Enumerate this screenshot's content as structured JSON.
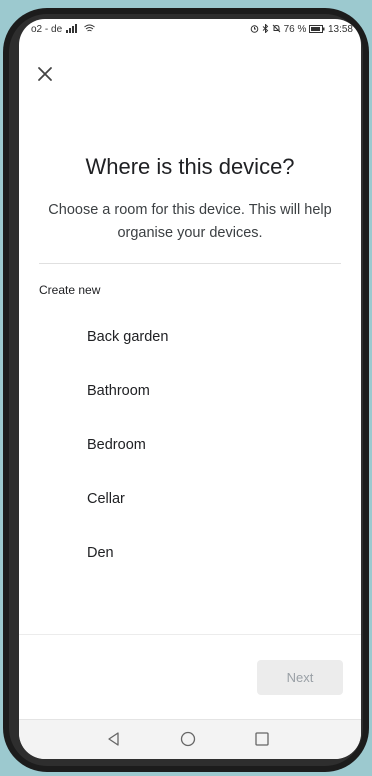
{
  "status": {
    "carrier": "o2 - de",
    "battery": "76 %",
    "time": "13:58"
  },
  "dialog": {
    "title": "Where is this device?",
    "subtitle": "Choose a room for this device. This will help organise your devices.",
    "section_label": "Create new",
    "rooms": [
      "Back garden",
      "Bathroom",
      "Bedroom",
      "Cellar",
      "Den"
    ],
    "next_label": "Next"
  },
  "icons": {
    "close": "close-icon",
    "back": "back-triangle-icon",
    "home": "home-circle-icon",
    "recents": "recents-square-icon"
  },
  "colors": {
    "background": "#9cc9cf",
    "text": "#202124",
    "button_disabled": "#ececec"
  }
}
